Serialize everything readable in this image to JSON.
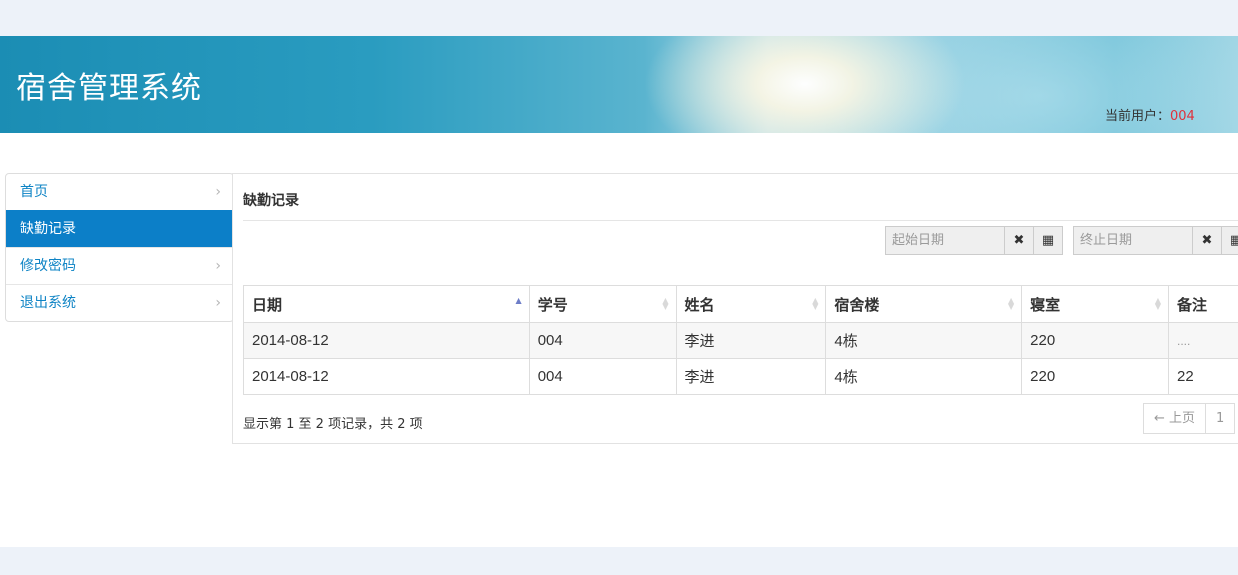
{
  "header": {
    "title": "宿舍管理系统",
    "current_user_label": "当前用户：",
    "current_user": "004",
    "user_color": "#e0313b"
  },
  "sidebar": {
    "items": [
      {
        "label": "首页",
        "active": false
      },
      {
        "label": "缺勤记录",
        "active": true
      },
      {
        "label": "修改密码",
        "active": false
      },
      {
        "label": "退出系统",
        "active": false
      }
    ],
    "chevron": "›"
  },
  "main": {
    "title": "缺勤记录",
    "start_date_placeholder": "起始日期",
    "end_date_placeholder": "终止日期",
    "clear_icon": "✖",
    "calendar_icon": "▦",
    "table": {
      "columns": [
        "日期",
        "学号",
        "姓名",
        "宿舍楼",
        "寝室",
        "备注"
      ],
      "sorted_column": "日期",
      "sort_direction": "ascending",
      "rows": [
        [
          "2014-08-12",
          "004",
          "李进",
          "4栋",
          "220",
          "...."
        ],
        [
          "2014-08-12",
          "004",
          "李进",
          "4栋",
          "220",
          "22"
        ]
      ]
    },
    "info": "显示第 1 至 2 项记录，共 2 项",
    "pagination": {
      "prev": "← 上页",
      "page": "1"
    }
  },
  "colors": {
    "accent": "#0c7fc8",
    "link": "#0f84c5",
    "page_band": "#edf2f9"
  }
}
